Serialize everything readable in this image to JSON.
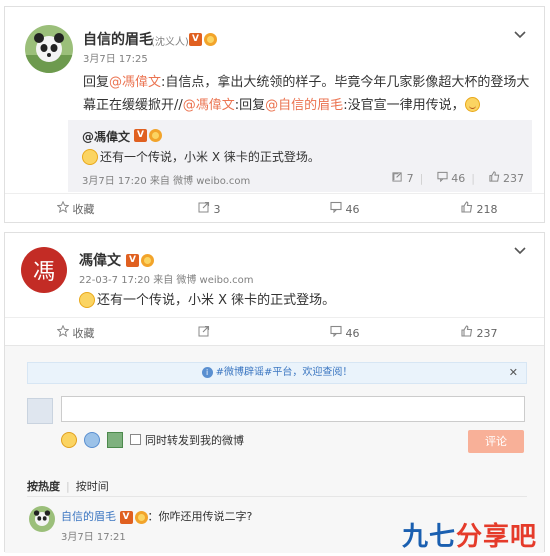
{
  "post1": {
    "author": "自信的眉毛",
    "author_note": "(沈义人)",
    "verified_badge": "V",
    "time": "3月7日 17:25",
    "text_parts": {
      "p1": "回复",
      "m1": "@馮偉文",
      "p2": ":自信点，拿出大统领的样子。毕竟今年几家影像超大杯的登场大幕正在缓缓掀开//",
      "m2": "@馮偉文",
      "p3": ":回复",
      "m3": "@自信的眉毛",
      "p4": ":没官宣一律用传说，"
    },
    "quote": {
      "author": "@馮偉文",
      "verified_badge": "V",
      "text": "还有一个传说，小米 X 徕卡的正式登场。",
      "time": "3月7日 17:20 来自 微博 weibo.com",
      "forwards": "7",
      "comments": "46",
      "likes": "237"
    },
    "actions": {
      "favorite": "收藏",
      "forward": "3",
      "comment": "46",
      "like": "218"
    }
  },
  "post2": {
    "author": "馮偉文",
    "avatar_char": "馮",
    "verified_badge": "V",
    "time": "22-03-7 17:20 来自 微博 weibo.com",
    "text": "还有一个传说，小米 X 徕卡的正式登场。",
    "actions": {
      "favorite": "收藏",
      "forward": "",
      "comment": "46",
      "like": "237"
    }
  },
  "comments": {
    "notice": "#微博辟谣#平台，欢迎查阅！",
    "forward_option": "同时转发到我的微博",
    "submit_label": "评论",
    "input_placeholder": "",
    "sort_hot": "按热度",
    "sort_time": "按时间",
    "reply": {
      "author": "自信的眉毛",
      "verified_badge": "V",
      "text": "：你咋还用传说二字?",
      "time": "3月7日 17:21"
    }
  },
  "watermark": {
    "part1": "九七",
    "part2": "分享吧"
  },
  "icons": [
    "chevron-down-icon",
    "favorite-icon",
    "forward-icon",
    "comment-icon",
    "like-icon",
    "info-icon",
    "close-icon",
    "emoji-icon",
    "gif-icon",
    "image-icon"
  ],
  "colors": {
    "mention": "#eb7350",
    "link_blue": "#3b76c1",
    "submit": "#f8b098"
  }
}
